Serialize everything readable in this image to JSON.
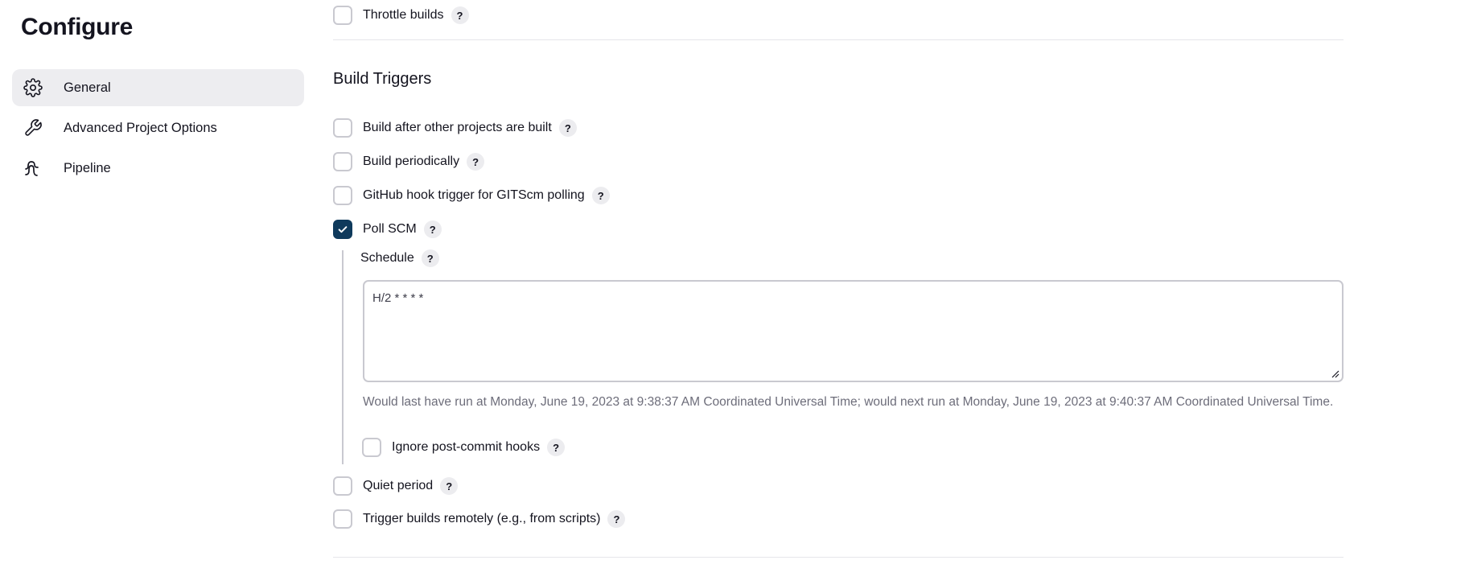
{
  "sidebar": {
    "title": "Configure",
    "items": [
      {
        "label": "General",
        "icon": "gear-icon",
        "active": true
      },
      {
        "label": "Advanced Project Options",
        "icon": "wrench-icon",
        "active": false
      },
      {
        "label": "Pipeline",
        "icon": "pipeline-icon",
        "active": false
      }
    ]
  },
  "main": {
    "throttle": {
      "label": "Throttle builds",
      "checked": false,
      "help": "?"
    },
    "build_triggers": {
      "title": "Build Triggers",
      "options": [
        {
          "label": "Build after other projects are built",
          "checked": false,
          "help": "?"
        },
        {
          "label": "Build periodically",
          "checked": false,
          "help": "?"
        },
        {
          "label": "GitHub hook trigger for GITScm polling",
          "checked": false,
          "help": "?"
        },
        {
          "label": "Poll SCM",
          "checked": true,
          "help": "?"
        }
      ],
      "poll_scm": {
        "schedule_label": "Schedule",
        "schedule_help": "?",
        "schedule_value": "H/2 * * * *",
        "hint": "Would last have run at Monday, June 19, 2023 at 9:38:37 AM Coordinated Universal Time; would next run at Monday, June 19, 2023 at 9:40:37 AM Coordinated Universal Time.",
        "ignore_hooks": {
          "label": "Ignore post-commit hooks",
          "checked": false,
          "help": "?"
        }
      },
      "more_options": [
        {
          "label": "Quiet period",
          "checked": false,
          "help": "?"
        },
        {
          "label": "Trigger builds remotely (e.g., from scripts)",
          "checked": false,
          "help": "?"
        }
      ]
    }
  },
  "colors": {
    "accent": "#0f3a5c",
    "active_nav_bg": "#ededf0",
    "hint_text": "#6d6d7a"
  }
}
